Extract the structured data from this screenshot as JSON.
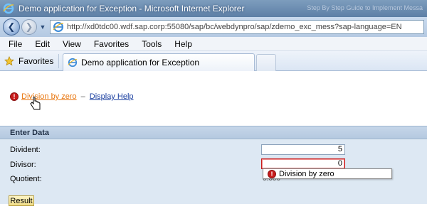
{
  "window": {
    "title": "Demo application for Exception - Microsoft Internet Explorer",
    "ghost_text": "Step By Step Guide to Implement Messa"
  },
  "address": {
    "url": "http://xd0tdc00.wdf.sap.corp:55080/sap/bc/webdynpro/sap/zdemo_exc_mess?sap-language=EN"
  },
  "menu": [
    "File",
    "Edit",
    "View",
    "Favorites",
    "Tools",
    "Help"
  ],
  "tabs": {
    "favorites_label": "Favorites",
    "active_tab_label": "Demo application for Exception"
  },
  "message": {
    "error_text": "Division by zero",
    "separator": "–",
    "help_text": "Display Help"
  },
  "form": {
    "section_title": "Enter Data",
    "dividend_label": "Divident:",
    "dividend_value": "5",
    "divisor_label": "Divisor:",
    "divisor_value": "0",
    "quotient_label": "Quotient:",
    "quotient_value": "0.000",
    "error_popup": "Division by zero",
    "result_button": "Result"
  }
}
